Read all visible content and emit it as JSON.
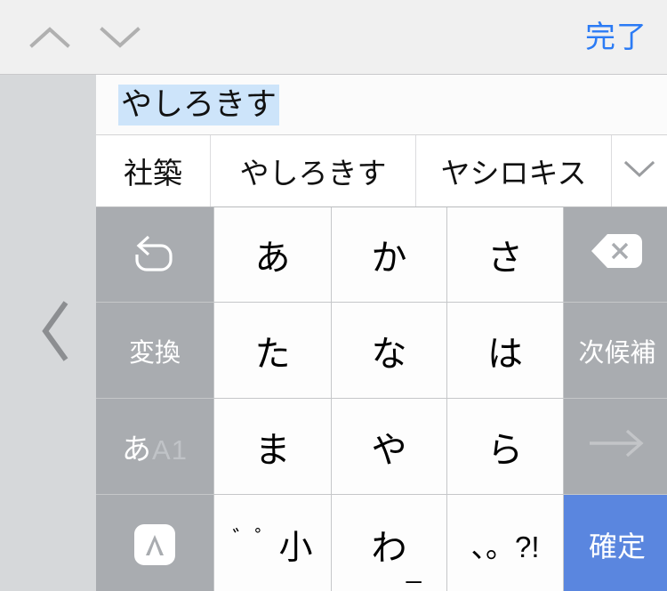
{
  "toolbar": {
    "prev_label": "",
    "next_label": "",
    "done_label": "完了",
    "done_color": "#2b7bf5",
    "prev_icon": "chevron-up-icon",
    "next_icon": "chevron-down-icon"
  },
  "rail": {
    "collapse_icon": "chevron-left-icon"
  },
  "input": {
    "composition_text": "やしろきす",
    "selection_color": "#cde4fa"
  },
  "candidates": {
    "items": [
      {
        "label": "社築"
      },
      {
        "label": "やしろきす"
      },
      {
        "label": "ヤシロキス"
      }
    ],
    "expand_icon": "chevron-down-icon"
  },
  "keypad": {
    "rows": [
      [
        {
          "label": "",
          "icon": "undo-icon",
          "type": "fn"
        },
        {
          "label": "あ",
          "type": "kana"
        },
        {
          "label": "か",
          "type": "kana"
        },
        {
          "label": "さ",
          "type": "kana"
        },
        {
          "label": "",
          "icon": "delete-icon",
          "type": "fn"
        }
      ],
      [
        {
          "label": "変換",
          "type": "fn"
        },
        {
          "label": "た",
          "type": "kana"
        },
        {
          "label": "な",
          "type": "kana"
        },
        {
          "label": "は",
          "type": "kana"
        },
        {
          "label": "次候補",
          "type": "fn"
        }
      ],
      [
        {
          "label": "あA1",
          "kana_part": "あ",
          "alnum_part": "A1",
          "type": "mode"
        },
        {
          "label": "ま",
          "type": "kana"
        },
        {
          "label": "や",
          "type": "kana"
        },
        {
          "label": "ら",
          "type": "kana"
        },
        {
          "label": "→",
          "icon": "arrow-right-icon",
          "type": "fn-dim"
        }
      ],
      [
        {
          "label": "",
          "icon": "keyboard-switch-icon",
          "type": "fn"
        },
        {
          "label": "゛゜小",
          "marks": "゛゜",
          "small": "小",
          "type": "kana"
        },
        {
          "label": "わ_",
          "base": "わ",
          "underscore": "_",
          "type": "kana"
        },
        {
          "label": "、。?!",
          "type": "kana"
        },
        {
          "label": "確定",
          "type": "confirm"
        }
      ]
    ]
  },
  "colors": {
    "function_key": "#a9acb0",
    "confirm_key": "#5a86df",
    "rail": "#d6d8da",
    "toolbar": "#f0f0f0",
    "key": "#fdfdfd"
  }
}
